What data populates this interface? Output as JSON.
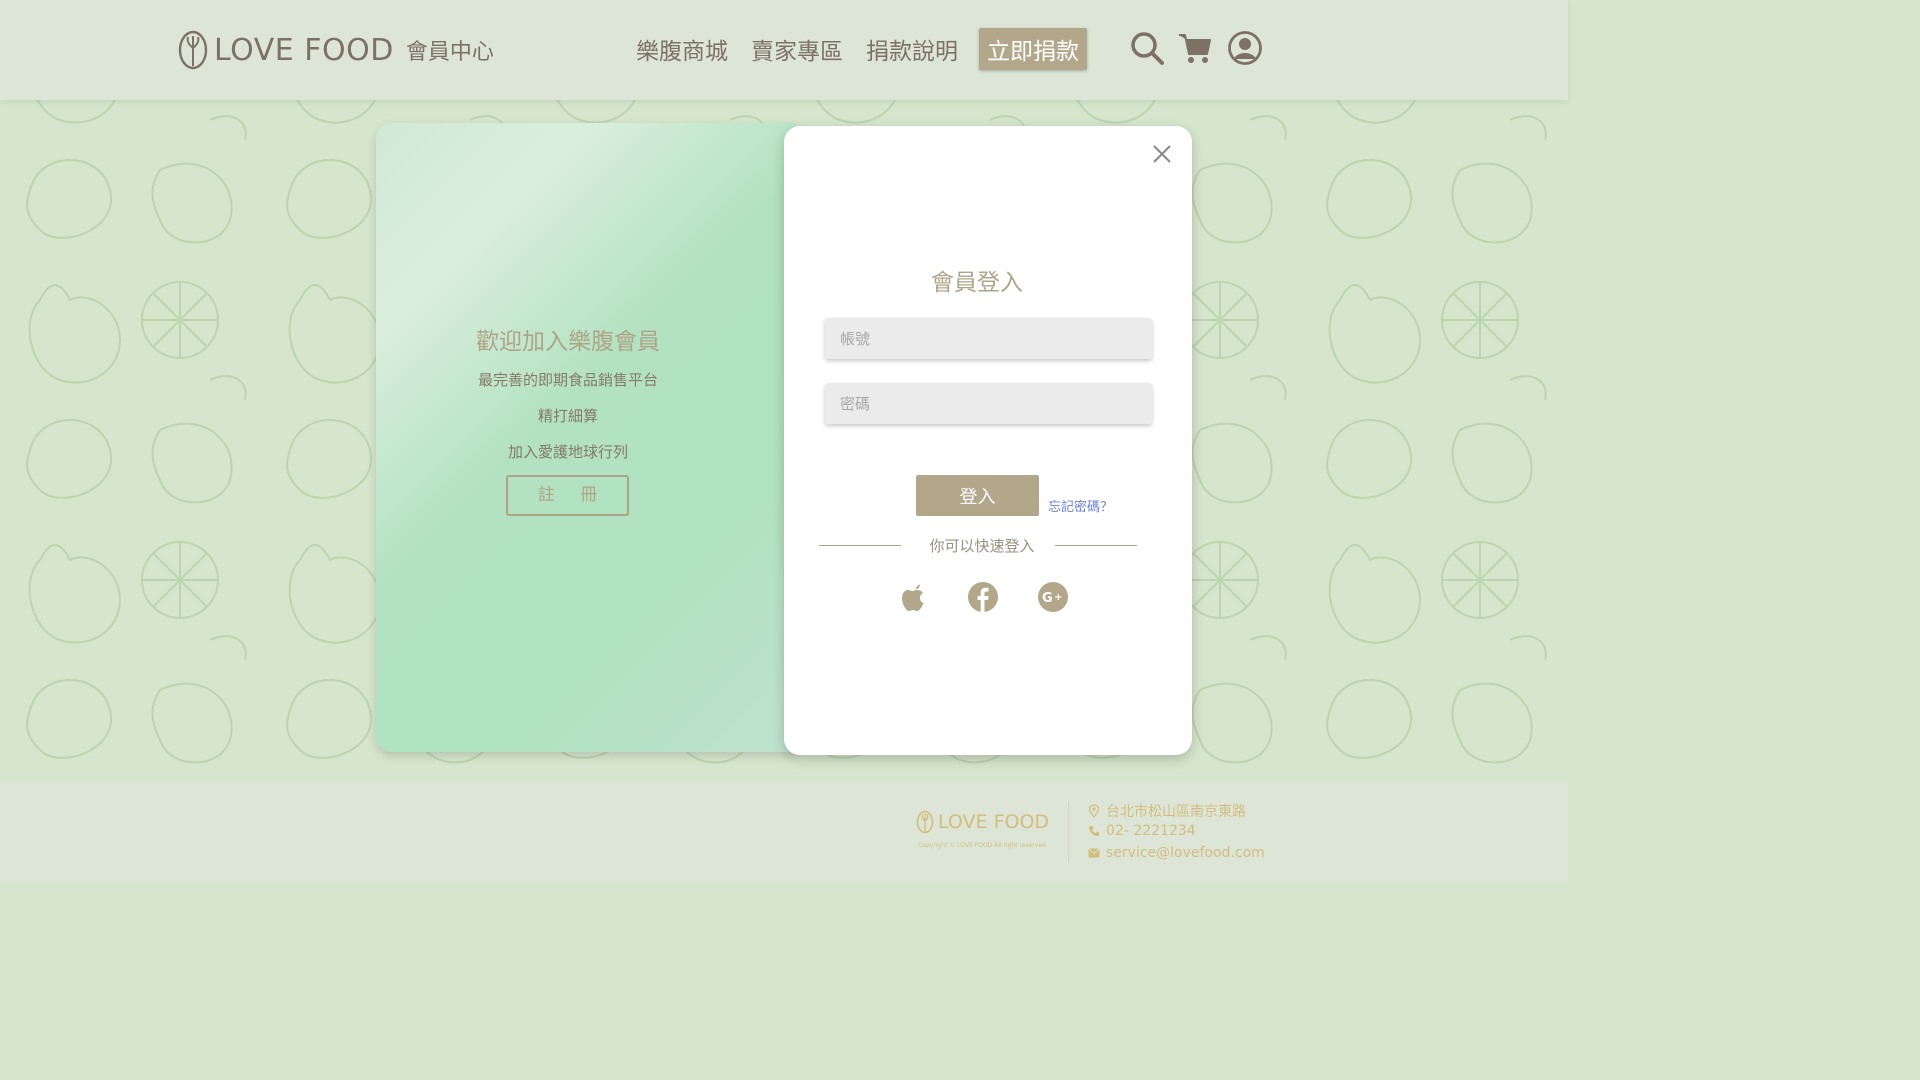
{
  "header": {
    "brand_name": "LOVE FOOD",
    "brand_sub": "會員中心",
    "nav": [
      "樂腹商城",
      "賣家專區",
      "捐款說明"
    ],
    "cta": "立即捐款",
    "icons": [
      "search-icon",
      "cart-icon",
      "user-icon"
    ]
  },
  "welcome": {
    "title": "歡迎加入樂腹會員",
    "lines": [
      "最完善的即期食品銷售平台",
      "精打細算",
      "加入愛護地球行列"
    ],
    "register_label": "註 冊"
  },
  "login": {
    "title": "會員登入",
    "account_placeholder": "帳號",
    "password_placeholder": "密碼",
    "login_label": "登入",
    "forgot_label": "忘記密碼？",
    "quick_login_label": "你可以快速登入",
    "social": [
      "apple-icon",
      "facebook-icon",
      "google-plus-icon"
    ]
  },
  "footer": {
    "brand_name": "LOVE FOOD",
    "copyright": "Copyright © LOVE FOOD All right reserved",
    "address": "台北市松山區南京東路",
    "phone": "02- 2221234",
    "email": "service@lovefood.com"
  },
  "colors": {
    "accent": "#b3a78b",
    "text_brown": "#7d7166",
    "footer_gold": "#d3bd7e",
    "background": "#d6e6cc"
  }
}
